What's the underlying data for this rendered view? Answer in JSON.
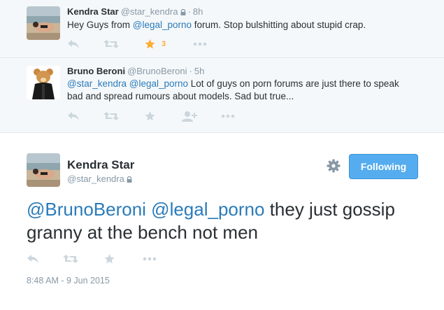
{
  "tweets": [
    {
      "fullname": "Kendra Star",
      "screen_name": "@star_kendra",
      "time": "8h",
      "text_segments": [
        {
          "text": "Hey Guys from ",
          "type": "text"
        },
        {
          "text": "@legal_porno",
          "type": "mention"
        },
        {
          "text": " forum. Stop bulshitting about stupid crap.",
          "type": "text"
        }
      ],
      "favorite_count": "3",
      "favorited": true,
      "avatar_icon": "user-avatar-beach",
      "locked": true
    },
    {
      "fullname": "Bruno Beroni",
      "screen_name": "@BrunoBeroni",
      "time": "5h",
      "text_segments": [
        {
          "text": "@star_kendra",
          "type": "mention"
        },
        {
          "text": " ",
          "type": "text"
        },
        {
          "text": "@legal_porno",
          "type": "mention"
        },
        {
          "text": " Lot of guys on porn forums are just there to speak bad and spread rumours about models. Sad but true...",
          "type": "text"
        }
      ],
      "avatar_icon": "user-avatar-teddy",
      "locked": false
    }
  ],
  "main_tweet": {
    "fullname": "Kendra Star",
    "screen_name": "@star_kendra",
    "follow_label": "Following",
    "text_segments": [
      {
        "text": "@BrunoBeroni",
        "type": "mention"
      },
      {
        "text": " ",
        "type": "text"
      },
      {
        "text": "@legal_porno",
        "type": "mention"
      },
      {
        "text": " they just gossip granny at the bench not men",
        "type": "text"
      }
    ],
    "timestamp": "8:48 AM - 9 Jun 2015",
    "avatar_icon": "user-avatar-beach",
    "locked": true
  },
  "colors": {
    "link": "#2b7bb9",
    "muted": "#8899a6",
    "favorite": "#ffac33",
    "follow_button": "#55acee",
    "context_bg": "#f5f8fa"
  },
  "icons": {
    "reply": "reply-icon",
    "retweet": "retweet-icon",
    "favorite": "star-icon",
    "more": "more-icon",
    "follow": "follow-icon",
    "settings": "gear-icon",
    "lock": "lock-icon"
  }
}
